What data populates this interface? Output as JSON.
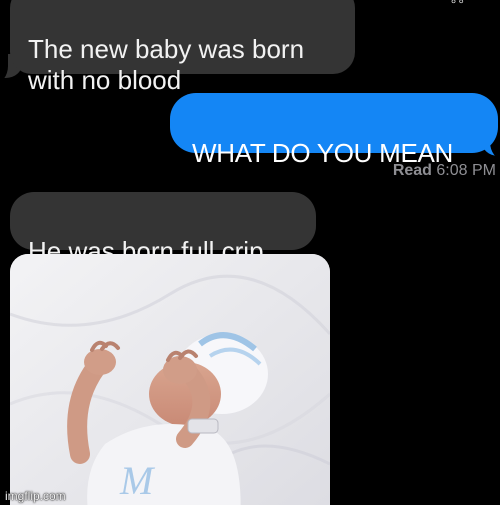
{
  "messages": {
    "incoming_1": "The new baby was born\nwith no blood",
    "outgoing_1": "WHAT DO YOU MEAN",
    "read_label": "Read",
    "read_time": "6:08 PM",
    "incoming_2": "He was born full crip"
  },
  "photo": {
    "subject": "newborn-baby-photo",
    "background_color": "#e9e9ec"
  },
  "watermark": "imgflip.com",
  "colors": {
    "incoming_bubble": "#343434",
    "outgoing_bubble": "#1486f5",
    "background": "#000000",
    "read_receipt": "#8e8e93"
  }
}
